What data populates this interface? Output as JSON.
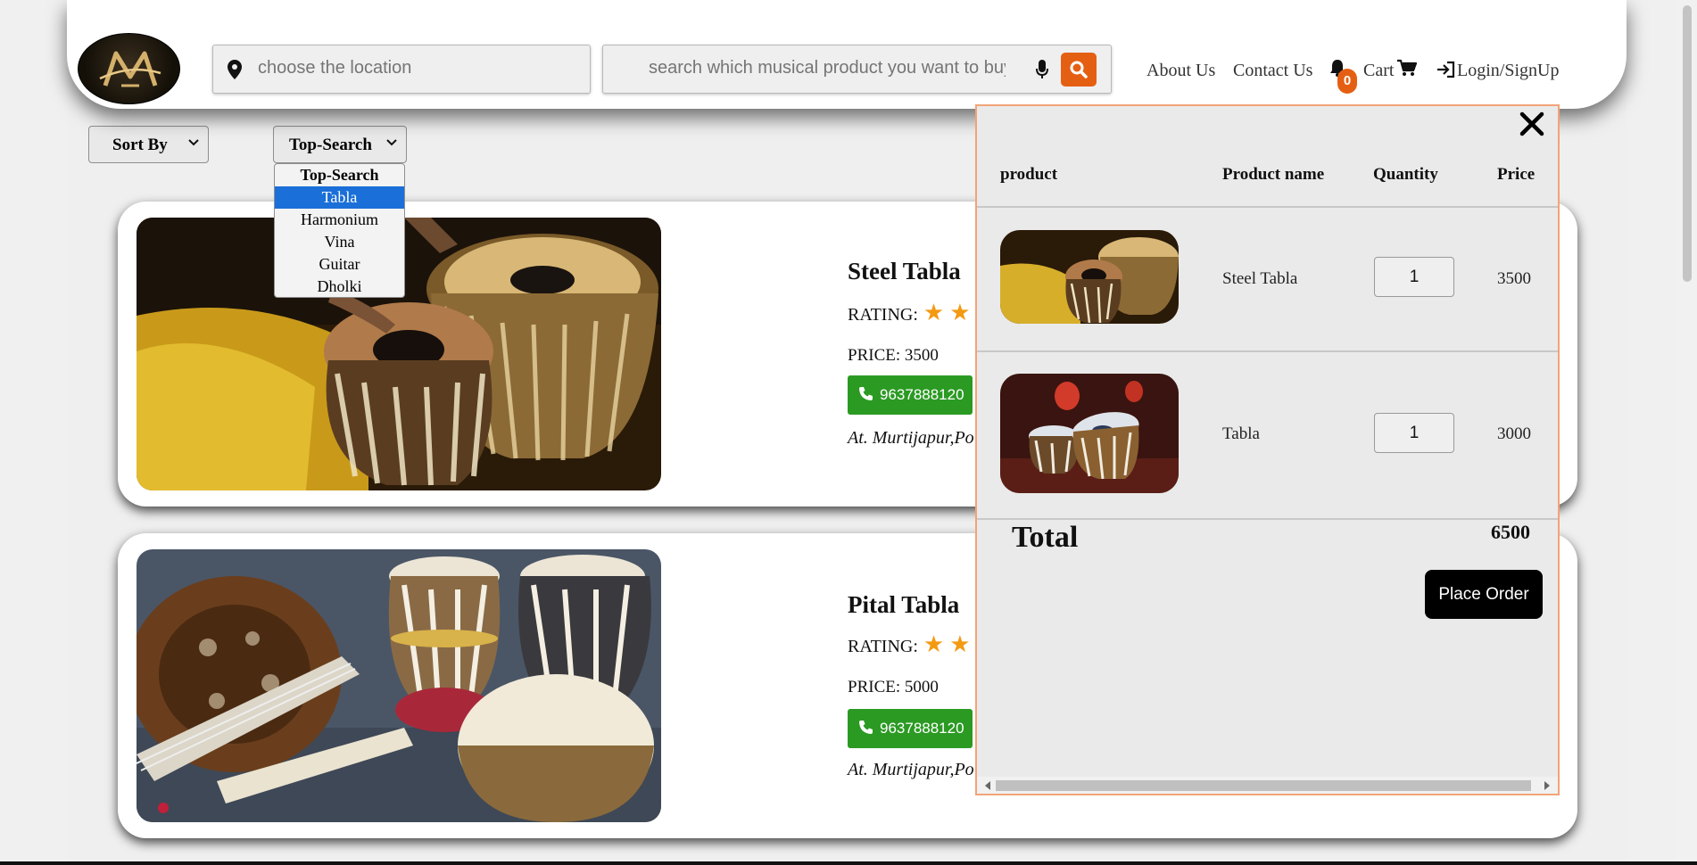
{
  "header": {
    "location_placeholder": "choose the location",
    "search_placeholder": "search which musical product you want to buy",
    "nav": {
      "about": "About Us",
      "contact": "Contact Us",
      "cart": "Cart",
      "login": "Login/SignUp"
    },
    "notification_count": "0",
    "accent_color": "#e55f13"
  },
  "filters": {
    "sort_label": "Sort By",
    "category_label": "Top-Search",
    "options": [
      "Top-Search",
      "Tabla",
      "Harmonium",
      "Vina",
      "Guitar",
      "Dholki"
    ],
    "highlighted_option": "Tabla"
  },
  "products": [
    {
      "title": "Steel Tabla",
      "rating_label": "RATING:",
      "stars_visible": 2,
      "price": "PRICE: 3500",
      "phone": "9637888120",
      "address": "At. Murtijapur,Po"
    },
    {
      "title": "Pital Tabla",
      "rating_label": "RATING:",
      "stars_visible": 2,
      "price": "PRICE: 5000",
      "phone": "9637888120",
      "address": "At. Murtijapur,Po"
    }
  ],
  "cart": {
    "headers": {
      "product": "product",
      "name": "Product name",
      "quantity": "Quantity",
      "price": "Price"
    },
    "items": [
      {
        "name": "Steel Tabla",
        "quantity": "1",
        "price": "3500"
      },
      {
        "name": "Tabla",
        "quantity": "1",
        "price": "3000"
      }
    ],
    "total_label": "Total",
    "total_value": "6500",
    "order_button": "Place Order",
    "border_color": "#f2a477"
  }
}
